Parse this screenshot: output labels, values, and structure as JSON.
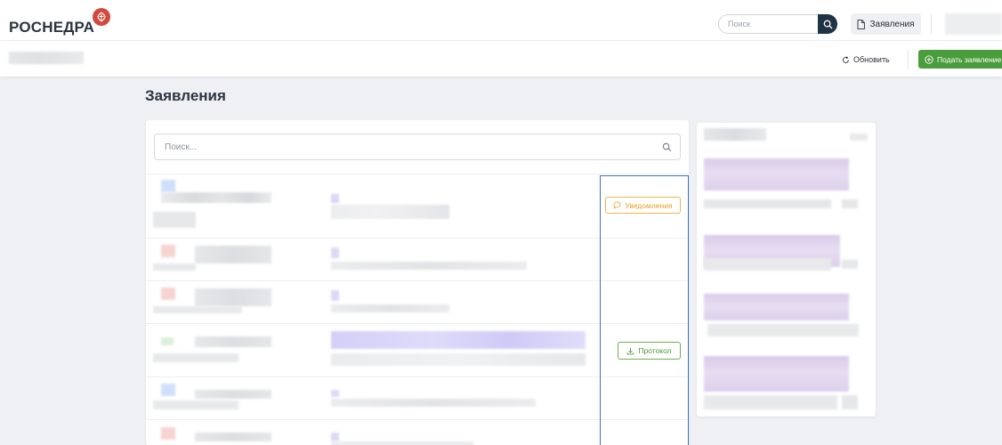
{
  "header": {
    "logo_text": "РОСНЕДРА",
    "search_placeholder": "Поиск",
    "applications_label": "Заявления"
  },
  "subheader": {
    "refresh_label": "Обновить",
    "submit_label": "Подать заявление"
  },
  "page": {
    "title": "Заявления",
    "list_search_placeholder": "Поиск..."
  },
  "actions": {
    "notifications_label": "Уведомления",
    "protocol_label": "Протокол"
  },
  "colors": {
    "accent_green": "#4a9d3c",
    "header_dark": "#1f3345",
    "notif_orange": "#f0b449",
    "highlight_blue": "#3b73b9"
  }
}
